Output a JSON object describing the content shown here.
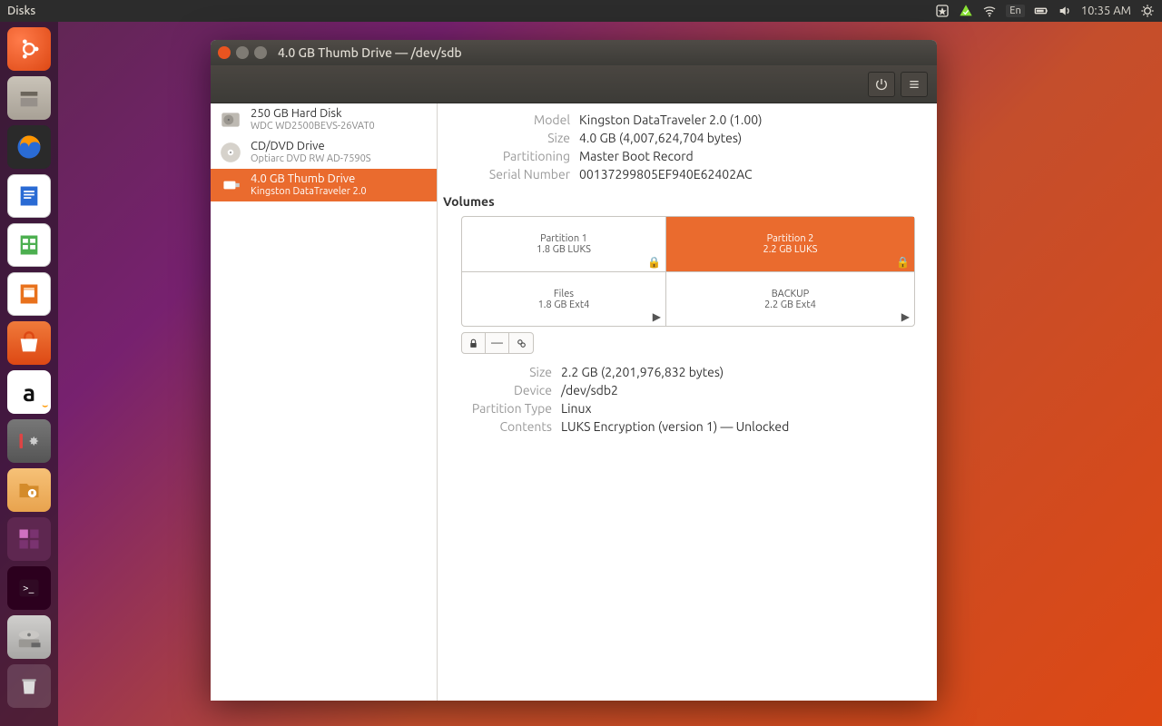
{
  "menubar": {
    "app": "Disks",
    "lang": "En",
    "time": "10:35 AM"
  },
  "window": {
    "title": "4.0 GB Thumb Drive — /dev/sdb"
  },
  "devices": [
    {
      "name": "250 GB Hard Disk",
      "sub": "WDC WD2500BEVS-26VAT0",
      "icon": "hdd"
    },
    {
      "name": "CD/DVD Drive",
      "sub": "Optiarc DVD RW AD-7590S",
      "icon": "cd"
    },
    {
      "name": "4.0 GB Thumb Drive",
      "sub": "Kingston DataTraveler 2.0",
      "icon": "usb",
      "selected": true
    }
  ],
  "summary": {
    "Model": "Kingston DataTraveler 2.0 (1.00)",
    "Size": "4.0 GB (4,007,624,704 bytes)",
    "Partitioning": "Master Boot Record",
    "SerialNumber": "00137299805EF940E62402AC"
  },
  "volumes_heading": "Volumes",
  "volumes": {
    "row1": [
      {
        "title": "Partition 1",
        "sub": "1.8 GB LUKS",
        "corner": "lock"
      },
      {
        "title": "Partition 2",
        "sub": "2.2 GB LUKS",
        "corner": "lock",
        "selected": true
      }
    ],
    "row2": [
      {
        "title": "Files",
        "sub": "1.8 GB Ext4",
        "corner": "play"
      },
      {
        "title": "BACKUP",
        "sub": "2.2 GB Ext4",
        "corner": "play"
      }
    ]
  },
  "partition": {
    "Size": "2.2 GB (2,201,976,832 bytes)",
    "Device": "/dev/sdb2",
    "PartitionType": "Linux",
    "Contents": "LUKS Encryption (version 1) — Unlocked"
  },
  "labels": {
    "Model": "Model",
    "Size": "Size",
    "Partitioning": "Partitioning",
    "SerialNumber": "Serial Number",
    "Device": "Device",
    "PartitionType": "Partition Type",
    "Contents": "Contents"
  }
}
